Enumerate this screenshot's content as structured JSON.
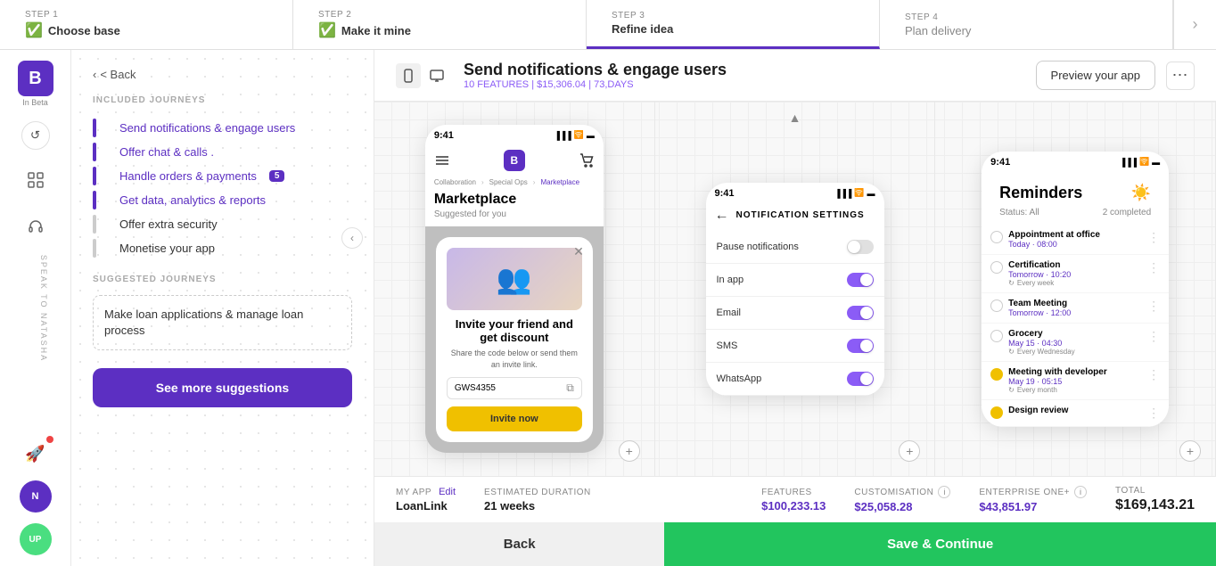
{
  "stepper": {
    "steps": [
      {
        "id": "step1",
        "number": "STEP 1",
        "label": "Choose base",
        "completed": true,
        "active": false
      },
      {
        "id": "step2",
        "number": "STEP 2",
        "label": "Make it mine",
        "completed": true,
        "active": false
      },
      {
        "id": "step3",
        "number": "STEP 3",
        "label": "Refine idea",
        "completed": false,
        "active": true
      },
      {
        "id": "step4",
        "number": "STEP 4",
        "label": "Plan delivery",
        "completed": false,
        "active": false
      }
    ]
  },
  "sidebar": {
    "logo_letter": "B",
    "logo_sub": "In Beta",
    "undo_icon": "↺",
    "grid_icon": "⊞",
    "headset_icon": "🎧",
    "rocket_icon": "🚀",
    "avatar_color": "#5c2fc2",
    "avatar_label": "UP"
  },
  "journey": {
    "back_label": "< Back",
    "included_label": "INCLUDED JOURNEYS",
    "items": [
      {
        "id": "j1",
        "label": "Send notifications & engage users",
        "active": true
      },
      {
        "id": "j2",
        "label": "Offer chat & calls .",
        "active": false
      },
      {
        "id": "j3",
        "label": "Handle orders & payments",
        "active": false,
        "badge": "5"
      },
      {
        "id": "j4",
        "label": "Get data, analytics & reports",
        "active": false
      },
      {
        "id": "j5",
        "label": "Offer extra security",
        "active": false
      },
      {
        "id": "j6",
        "label": "Monetise your app",
        "active": false
      }
    ],
    "suggested_label": "SUGGESTED JOURNEYS",
    "suggested_items": [
      {
        "id": "s1",
        "label": "Make loan applications & manage loan process"
      }
    ],
    "see_more_label": "See more suggestions"
  },
  "topbar": {
    "page_title": "Send notifications & engage users",
    "page_subtitle": "10 FEATURES | $15,306.04 | 73,DAYS",
    "preview_label": "Preview your app",
    "more_dots": "⋯"
  },
  "screens": {
    "screen1": {
      "time": "9:41",
      "nav": [
        "Collaboration",
        "Special Ops",
        "Marketplace"
      ],
      "logo": "B",
      "title": "Marketplace",
      "subtitle": "Suggested for you",
      "modal": {
        "title": "Invite your friend and get discount",
        "desc": "Share the code below or send them an invite link.",
        "code": "GWS4355",
        "btn_label": "Invite now"
      }
    },
    "screen2": {
      "time": "9:41",
      "title": "NOTIFICATION SETTINGS",
      "rows": [
        {
          "label": "Pause notifications",
          "on": false
        },
        {
          "label": "In app",
          "on": true
        },
        {
          "label": "Email",
          "on": true
        },
        {
          "label": "SMS",
          "on": true
        },
        {
          "label": "WhatsApp",
          "on": true
        }
      ]
    },
    "screen3": {
      "time": "9:41",
      "title": "Reminders",
      "filter": "Status: All",
      "completed": "2 completed",
      "items": [
        {
          "title": "Appointment at office",
          "time": "Today · 08:00",
          "recur": null,
          "checked": false
        },
        {
          "title": "Certification",
          "time": "Tomorrow · 10:20",
          "recur": "Every week",
          "checked": false
        },
        {
          "title": "Team Meeting",
          "time": "Tomorrow · 12:00",
          "recur": null,
          "checked": false
        },
        {
          "title": "Grocery",
          "time": "May 15 · 04:30",
          "recur": "Every Wednesday",
          "checked": false
        },
        {
          "title": "Meeting with developer",
          "time": "May 19 · 05:15",
          "recur": "Every month",
          "checked": true
        },
        {
          "title": "Design review",
          "time": "",
          "recur": null,
          "checked": true
        }
      ]
    }
  },
  "bottombar": {
    "app_label": "MY APP",
    "app_name": "LoanLink",
    "edit_label": "Edit",
    "duration_label": "ESTIMATED DURATION",
    "duration_value": "21 weeks",
    "features_label": "FEATURES",
    "features_value": "$100,233.13",
    "custom_label": "CUSTOMISATION",
    "custom_value": "$25,058.28",
    "enterprise_label": "ENTERPRISE ONE+",
    "enterprise_value": "$43,851.97",
    "total_label": "TOTAL",
    "total_value": "$169,143.21",
    "back_label": "Back",
    "save_label": "Save & Continue"
  }
}
